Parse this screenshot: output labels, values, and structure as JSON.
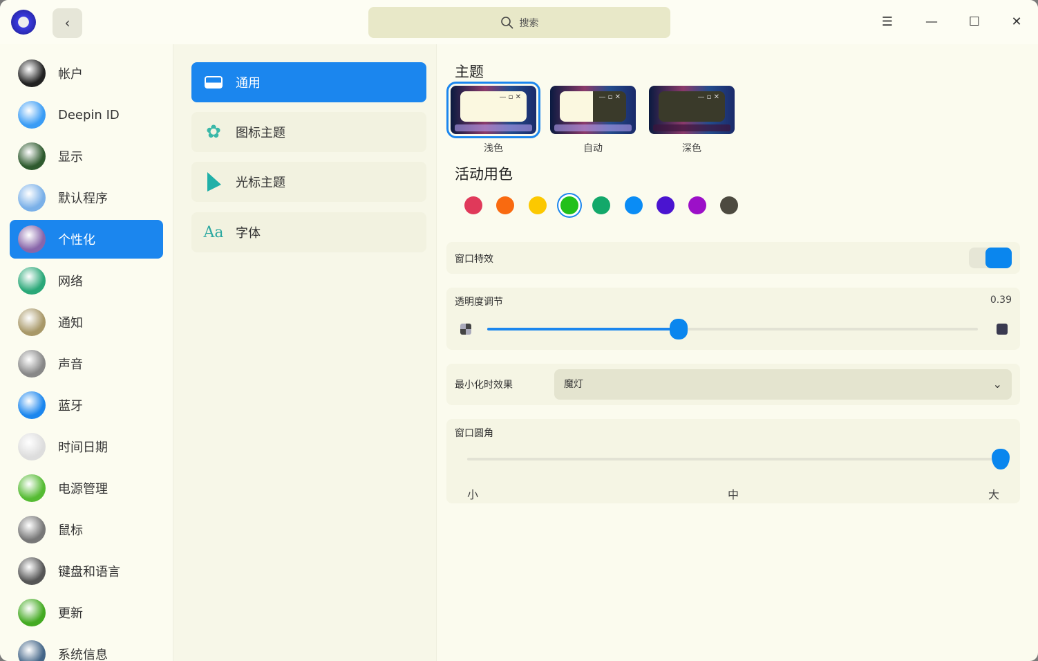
{
  "titlebar": {
    "search_placeholder": "搜索",
    "menu_icon": "menu-icon",
    "back_icon": "chevron-left-icon"
  },
  "sidebar": {
    "items": [
      {
        "label": "帐户",
        "icon": "account-icon",
        "color": "#222"
      },
      {
        "label": "Deepin ID",
        "icon": "cloud-icon",
        "color": "#3a9cf5"
      },
      {
        "label": "显示",
        "icon": "display-icon",
        "color": "#2e5a2e"
      },
      {
        "label": "默认程序",
        "icon": "default-apps-icon",
        "color": "#7ab0e8"
      },
      {
        "label": "个性化",
        "icon": "personalization-icon",
        "color": "#8866aa"
      },
      {
        "label": "网络",
        "icon": "network-icon",
        "color": "#2aa878"
      },
      {
        "label": "通知",
        "icon": "bell-icon",
        "color": "#a89868"
      },
      {
        "label": "声音",
        "icon": "speaker-icon",
        "color": "#888"
      },
      {
        "label": "蓝牙",
        "icon": "bluetooth-icon",
        "color": "#1b86ee"
      },
      {
        "label": "时间日期",
        "icon": "clock-icon",
        "color": "#ddd"
      },
      {
        "label": "电源管理",
        "icon": "battery-icon",
        "color": "#55bb33"
      },
      {
        "label": "鼠标",
        "icon": "mouse-icon",
        "color": "#777"
      },
      {
        "label": "键盘和语言",
        "icon": "keyboard-icon",
        "color": "#555"
      },
      {
        "label": "更新",
        "icon": "update-icon",
        "color": "#44aa22"
      },
      {
        "label": "系统信息",
        "icon": "system-info-icon",
        "color": "#446688"
      }
    ],
    "active": 4
  },
  "categories": [
    {
      "label": "通用",
      "icon": "window-icon"
    },
    {
      "label": "图标主题",
      "icon": "flower-icon"
    },
    {
      "label": "光标主题",
      "icon": "cursor-icon"
    },
    {
      "label": "字体",
      "icon": "font-icon",
      "glyph": "Aa"
    }
  ],
  "theme": {
    "title": "主题",
    "options": [
      {
        "label": "浅色"
      },
      {
        "label": "自动"
      },
      {
        "label": "深色"
      }
    ],
    "selected": 0
  },
  "accent": {
    "title": "活动用色",
    "colors": [
      "#e0395a",
      "#f96a10",
      "#fcc800",
      "#22c01a",
      "#13a86a",
      "#0a8cf5",
      "#4a14d0",
      "#9c10c8",
      "#4d4a40"
    ],
    "selected": 3
  },
  "window_effect": {
    "label": "窗口特效",
    "on": true
  },
  "transparency": {
    "label": "透明度调节",
    "value": "0.39",
    "fraction": 0.39
  },
  "minimize": {
    "label": "最小化时效果",
    "value": "魔灯"
  },
  "corner": {
    "label": "窗口圆角",
    "ticks": [
      "小",
      "中",
      "大"
    ],
    "fraction": 1.0
  }
}
